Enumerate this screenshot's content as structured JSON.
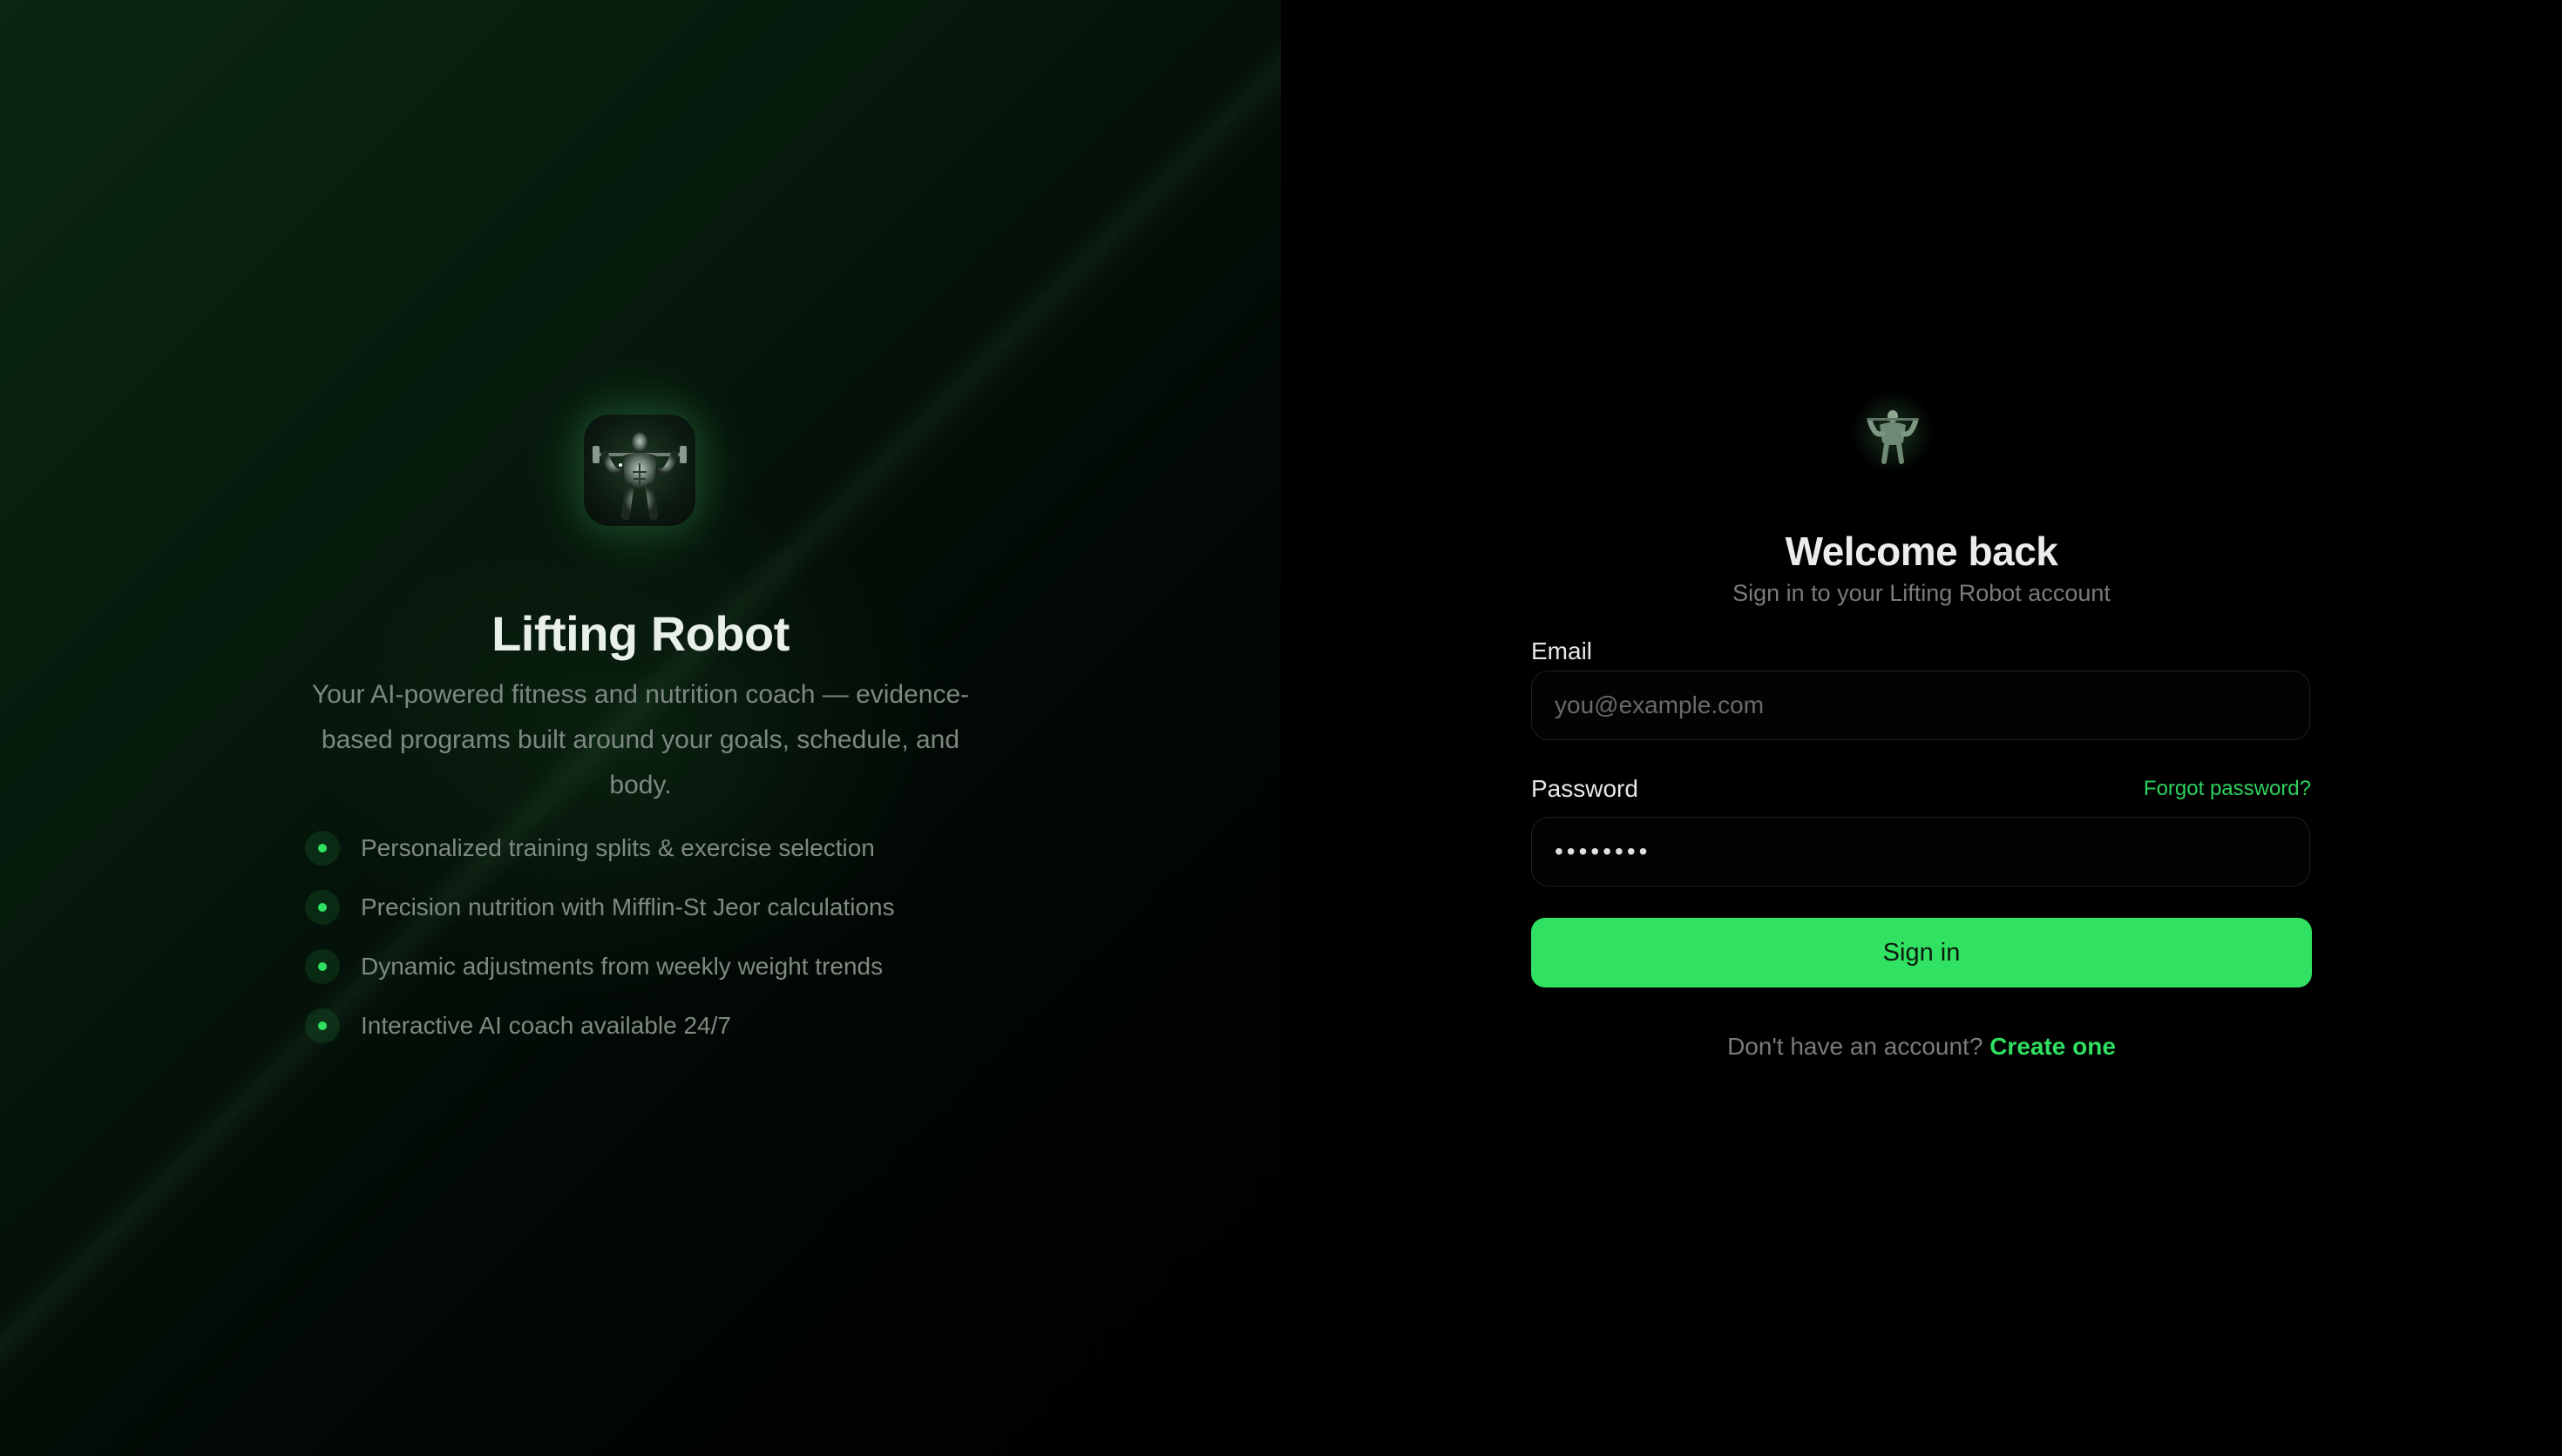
{
  "hero": {
    "logo_icon": "robot-bodybuilder-logo",
    "title": "Lifting Robot",
    "description": "Your AI-powered fitness and nutrition coach — evidence-based programs built around your goals, schedule, and body.",
    "features": [
      {
        "text": "Personalized training splits & exercise selection"
      },
      {
        "text": "Precision nutrition with Mifflin-St Jeor calculations"
      },
      {
        "text": "Dynamic adjustments from weekly weight trends"
      },
      {
        "text": "Interactive AI coach available 24/7"
      }
    ]
  },
  "auth": {
    "logo_icon": "robot-bodybuilder-logo",
    "title": "Welcome back",
    "subtitle": "Sign in to your Lifting Robot account",
    "email": {
      "label": "Email",
      "placeholder": "you@example.com",
      "value": ""
    },
    "password": {
      "label": "Password",
      "value": "••••••••",
      "forgot_label": "Forgot password?"
    },
    "submit_label": "Sign in",
    "signup_prompt": "Don't have an account?",
    "signup_link": "Create one"
  },
  "colors": {
    "accent": "#31e162",
    "background": "#000000",
    "hero_gradient_start": "#0a2712"
  }
}
